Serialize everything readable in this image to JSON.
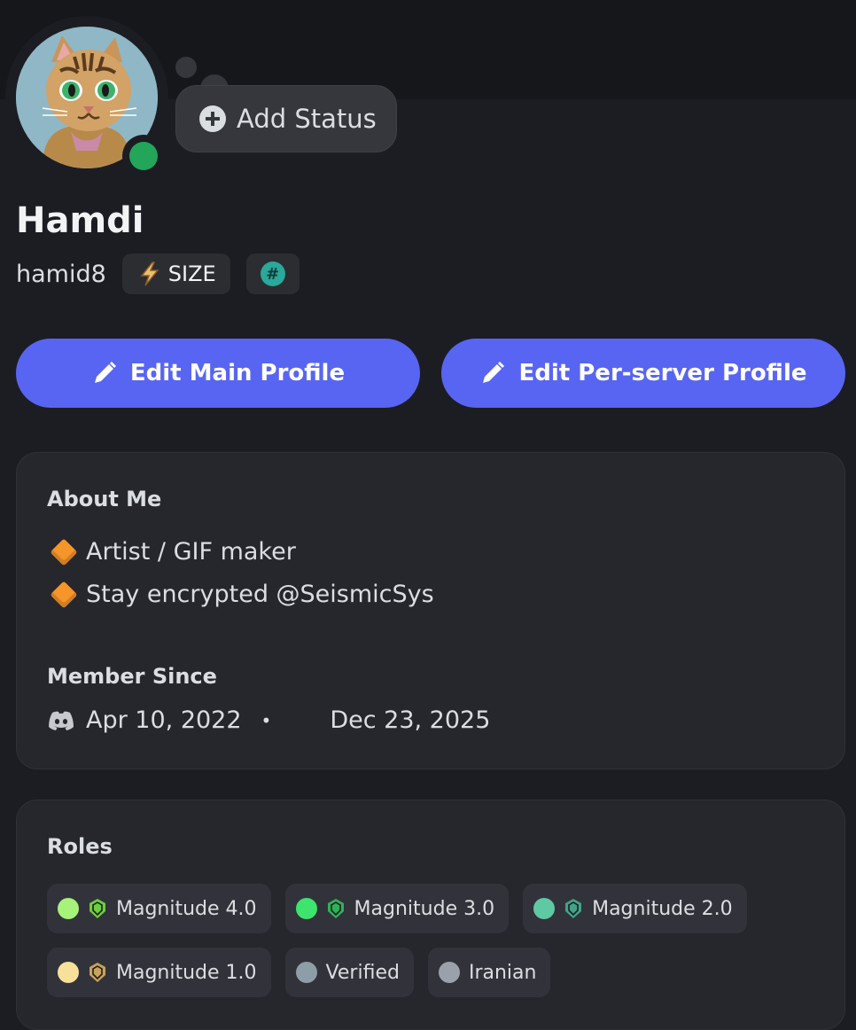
{
  "status": {
    "add_status_label": "Add Status",
    "indicator": "online"
  },
  "profile": {
    "display_name": "Hamdi",
    "username": "hamid8",
    "tag_label": "SIZE",
    "tag_icon": "lightning-bolt-icon",
    "badge_symbol": "#"
  },
  "actions": {
    "edit_main": "Edit Main Profile",
    "edit_server": "Edit Per-server Profile"
  },
  "about": {
    "title": "About Me",
    "lines": [
      "Artist / GIF maker",
      "Stay encrypted @SeismicSys"
    ]
  },
  "member_since": {
    "title": "Member Since",
    "discord_date": "Apr 10, 2022",
    "separator": "•",
    "server_date": "Dec 23, 2025"
  },
  "roles": {
    "title": "Roles",
    "items": [
      {
        "name": "Magnitude 4.0",
        "color": "#a6f27a",
        "icon": "seismic-badge-icon",
        "icon_color": "#6ccf3e"
      },
      {
        "name": "Magnitude 3.0",
        "color": "#3de46e",
        "icon": "seismic-badge-icon",
        "icon_color": "#2fb35a"
      },
      {
        "name": "Magnitude 2.0",
        "color": "#5fc9a4",
        "icon": "seismic-badge-icon",
        "icon_color": "#3fa488"
      },
      {
        "name": "Magnitude 1.0",
        "color": "#f7e09a",
        "icon": "seismic-badge-icon",
        "icon_color": "#c9a35a"
      },
      {
        "name": "Verified",
        "color": "#8e9ea8"
      },
      {
        "name": "Iranian",
        "color": "#9aa1aa"
      }
    ]
  },
  "colors": {
    "accent": "#5865f2",
    "online": "#23a55a",
    "background": "#1c1d22",
    "card": "#26272d"
  }
}
